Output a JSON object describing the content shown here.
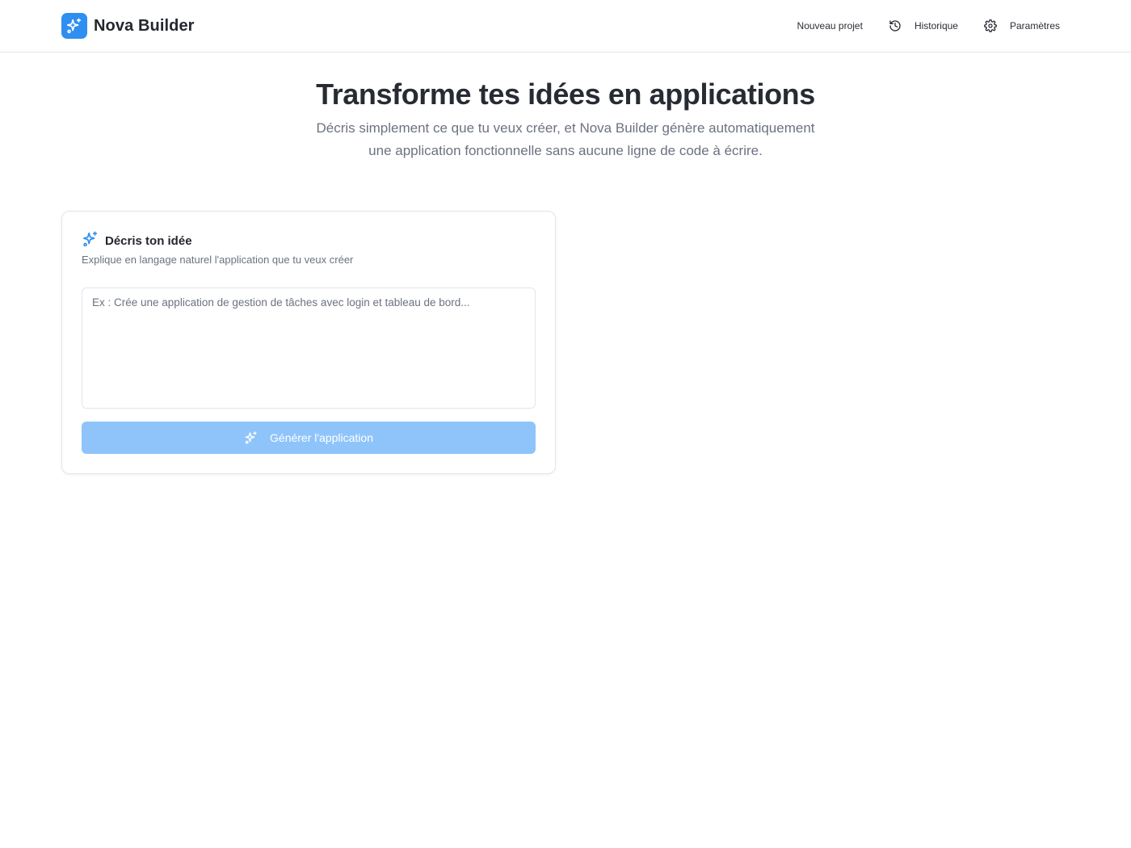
{
  "brand": {
    "name": "Nova Builder",
    "logo_icon": "sparkles-icon",
    "accent_color": "#2f8ff0"
  },
  "nav": {
    "new_project": {
      "label": "Nouveau projet"
    },
    "history": {
      "label": "Historique",
      "icon": "history-icon"
    },
    "settings": {
      "label": "Paramètres",
      "icon": "gear-icon"
    }
  },
  "hero": {
    "title": "Transforme tes idées en applications",
    "subtitle": "Décris simplement ce que tu veux créer, et Nova Builder génère automatiquement une application fonctionnelle sans aucune ligne de code à écrire."
  },
  "card": {
    "icon": "sparkles-icon",
    "title": "Décris ton idée",
    "description": "Explique en langage naturel l'application que tu veux créer",
    "input": {
      "value": "",
      "placeholder": "Ex : Crée une application de gestion de tâches avec login et tableau de bord..."
    },
    "button": {
      "label": "Générer l'application",
      "icon": "sparkles-icon",
      "color": "#8fc4fa",
      "state": "disabled"
    }
  }
}
